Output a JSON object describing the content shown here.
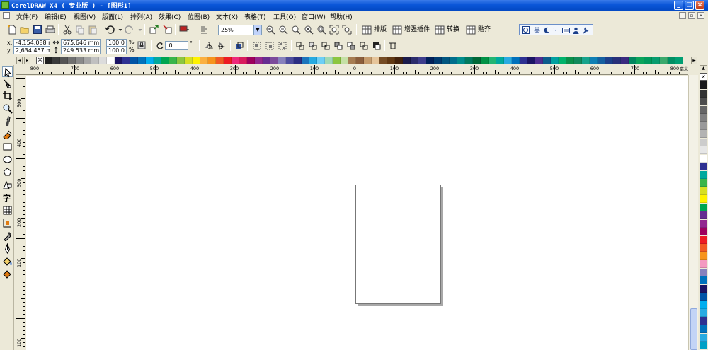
{
  "window": {
    "title": "CorelDRAW X4 ( 专业版 ) - [图形1]",
    "buttons": [
      "_",
      "□",
      "×"
    ]
  },
  "menu": {
    "items": [
      "文件(F)",
      "编辑(E)",
      "视图(V)",
      "版面(L)",
      "排列(A)",
      "效果(C)",
      "位图(B)",
      "文本(X)",
      "表格(T)",
      "工具(O)",
      "窗口(W)",
      "帮助(H)"
    ]
  },
  "toolbar": {
    "zoom_value": "25%",
    "plugin_buttons": [
      "排版",
      "增强插件",
      "转换",
      "贴齐"
    ],
    "ime_label": "英"
  },
  "property_bar": {
    "x_label": "x:",
    "y_label": "y:",
    "x_value": "-4,154.088 mm",
    "y_value": "2,634.457 mm",
    "width_value": "675.646 mm",
    "height_value": "249.533 mm",
    "scale_x": "100.0",
    "scale_y": "100.0",
    "percent": "%",
    "rotation": ".0",
    "degree": "°"
  },
  "ruler": {
    "h_labels": [
      "800",
      "700",
      "600",
      "500",
      "400",
      "300",
      "200",
      "100",
      "0",
      "100",
      "200",
      "300",
      "400",
      "500",
      "600",
      "700",
      "800"
    ],
    "h_unit": "毫米",
    "v_labels": [
      "500",
      "400",
      "300",
      "200",
      "100",
      "100"
    ]
  },
  "toolbox": {
    "text_tool": "字"
  },
  "colors": {
    "palette_top": [
      "#202020",
      "#3a3a3a",
      "#555555",
      "#707070",
      "#8a8a8a",
      "#a5a5a5",
      "#c0c0c0",
      "#dcdcdc",
      "#ffffff",
      "#1b1464",
      "#2e3192",
      "#0054a6",
      "#0072bc",
      "#00aeef",
      "#00a99d",
      "#00a651",
      "#39b54a",
      "#8dc63f",
      "#d7df23",
      "#fff200",
      "#fbb040",
      "#f7941d",
      "#f15a24",
      "#ed1c24",
      "#ee2a7b",
      "#d91b5c",
      "#9e005d",
      "#92278f",
      "#662d91",
      "#7c4a9b",
      "#8781bd",
      "#4d4d9e",
      "#2b2e83",
      "#1c75bc",
      "#27aae1",
      "#6dcff6",
      "#a0d9b4",
      "#8cc63f",
      "#c5e0a5",
      "#a67c52",
      "#8b5e3c",
      "#c69c6d",
      "#e6c59a",
      "#754c24",
      "#603813",
      "#42210b",
      "#1a1a4a",
      "#2c2c6c",
      "#3d3d8c",
      "#00205b",
      "#003a70",
      "#00557f",
      "#006e8c",
      "#008c8c",
      "#007a5e",
      "#006837",
      "#009245",
      "#22b573",
      "#00a99d",
      "#29abe2",
      "#0071bc",
      "#2e3192",
      "#1b1464",
      "#4d2e91",
      "#0d5c8c",
      "#00a0a0",
      "#00b26a",
      "#0a8f4a",
      "#118a5c",
      "#16a38c",
      "#0f7fb5",
      "#155fa0",
      "#1d3f8a",
      "#28307a",
      "#3a2a80",
      "#00865e",
      "#0aa35a",
      "#00995c",
      "#079c6e",
      "#3aa96c",
      "#008f63",
      "#009f72"
    ],
    "palette_right": [
      "#1a1a1a",
      "#333333",
      "#4d4d4d",
      "#666666",
      "#808080",
      "#999999",
      "#b3b3b3",
      "#cccccc",
      "#e6e6e6",
      "#ffffff",
      "#2e3192",
      "#00a99d",
      "#39b54a",
      "#d7df23",
      "#fff200",
      "#00a651",
      "#662d91",
      "#92278f",
      "#9e005d",
      "#ed1c24",
      "#f15a24",
      "#f7941d",
      "#f49ac1",
      "#8781bd",
      "#0072bc",
      "#1b1464",
      "#0054a6",
      "#00aeef",
      "#29abe2",
      "#2e3192",
      "#0071bc",
      "#27aae1",
      "#00a0c6",
      "#1c75bc"
    ]
  }
}
